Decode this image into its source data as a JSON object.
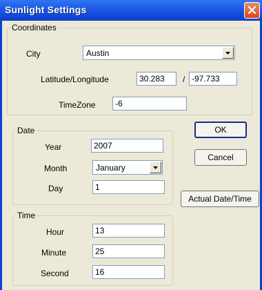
{
  "window": {
    "title": "Sunlight Settings"
  },
  "coordinates": {
    "legend": "Coordinates",
    "city_label": "City",
    "city_value": "Austin",
    "latlon_label": "Latitude/Longitude",
    "latitude": "30.283",
    "separator": "/",
    "longitude": "-97.733",
    "timezone_label": "TimeZone",
    "timezone": "-6"
  },
  "date": {
    "legend": "Date",
    "year_label": "Year",
    "year": "2007",
    "month_label": "Month",
    "month": "January",
    "day_label": "Day",
    "day": "1"
  },
  "time": {
    "legend": "Time",
    "hour_label": "Hour",
    "hour": "13",
    "minute_label": "Minute",
    "minute": "25",
    "second_label": "Second",
    "second": "16"
  },
  "buttons": {
    "ok": "OK",
    "cancel": "Cancel",
    "actual": "Actual Date/Time"
  },
  "icons": {
    "close": "close-icon",
    "dropdown": "chevron-down-icon"
  },
  "colors": {
    "titlebar": "#0a3fc9",
    "close": "#d8461d",
    "face": "#ece9d8"
  }
}
